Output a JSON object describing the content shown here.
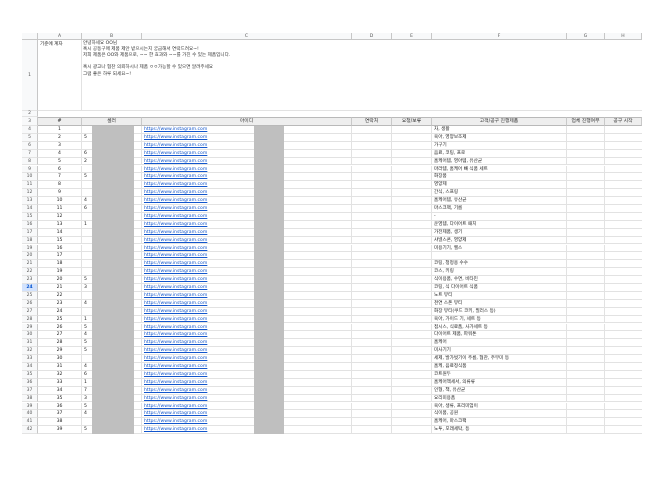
{
  "columns": [
    "A",
    "B",
    "C",
    "D",
    "E",
    "F",
    "G",
    "H"
  ],
  "intro": {
    "label": "기준에 계자",
    "lines": [
      "안녕하세요 OO님",
      "혹시 공동구매 제품 제안 받으시는지 궁금해서 연락드려요~!",
      "저희 제품은 OO와 제품으로, ~~ 한 효과와 ~~를 가진 수 있는 제품입니다.",
      "",
      "혹시 광고나 협찬 의뢰하시나 제품 ㅇㅇ가능할 수 있으면 알려주세요",
      "그럼 좋은 하루 되세요~!"
    ]
  },
  "headers": [
    "#",
    "셀러",
    "아이디",
    "연락처",
    "요청/보류",
    "고객/공구 진행제품",
    "업체 진행여부",
    "공구 시작"
  ],
  "url_text": "https://www.instagram.com",
  "selected_row": "24",
  "rows": [
    {
      "r": "4",
      "n": "1",
      "b": "",
      "f": "차, 생활"
    },
    {
      "r": "5",
      "n": "2",
      "b": "5",
      "f": "육아, 영양보조제"
    },
    {
      "r": "6",
      "n": "3",
      "b": "",
      "f": "가구기"
    },
    {
      "r": "7",
      "n": "4",
      "b": "6",
      "f": "음료, 코팅, 프로"
    },
    {
      "r": "8",
      "n": "5",
      "b": "2",
      "f": "홈케어템, 영아템, 유산균"
    },
    {
      "r": "9",
      "n": "6",
      "b": "",
      "f": "마라템, 홈케어 빼 식품 세트"
    },
    {
      "r": "10",
      "n": "7",
      "b": "5",
      "f": "화장품"
    },
    {
      "r": "11",
      "n": "8",
      "b": "",
      "f": "영양제"
    },
    {
      "r": "12",
      "n": "9",
      "b": "",
      "f": "간식, 스프링"
    },
    {
      "r": "13",
      "n": "10",
      "b": "4",
      "f": "홈케어템, 유산균"
    },
    {
      "r": "14",
      "n": "11",
      "b": "6",
      "f": "마스크팩, 기름"
    },
    {
      "r": "15",
      "n": "12",
      "b": "",
      "f": "-"
    },
    {
      "r": "16",
      "n": "13",
      "b": "1",
      "f": "운영템, 다이어트 패치"
    },
    {
      "r": "17",
      "n": "14",
      "b": "",
      "f": "가전제품, 생기"
    },
    {
      "r": "18",
      "n": "15",
      "b": "",
      "f": "샤넬스콘, 영양제"
    },
    {
      "r": "19",
      "n": "16",
      "b": "",
      "f": "미용기기, 헬스"
    },
    {
      "r": "20",
      "n": "17",
      "b": "",
      "f": ""
    },
    {
      "r": "21",
      "n": "18",
      "b": "",
      "f": "코팅, 청정용 수수"
    },
    {
      "r": "22",
      "n": "19",
      "b": "",
      "f": "코스, 키링"
    },
    {
      "r": "23",
      "n": "20",
      "b": "5",
      "f": "식이용품, 수면, 비타민"
    },
    {
      "r": "24",
      "n": "21",
      "b": "3",
      "f": "코팅, 식 다이어트 식품"
    },
    {
      "r": "25",
      "n": "22",
      "b": "",
      "f": "노트 뷰티"
    },
    {
      "r": "26",
      "n": "23",
      "b": "4",
      "f": "천연 스폰 뷰티"
    },
    {
      "r": "27",
      "n": "24",
      "b": "",
      "f": "화장 뷰티(쿠드 코키, 필러스 등)"
    },
    {
      "r": "28",
      "n": "25",
      "b": "1",
      "f": "육아, 가이드 기, 세트 등"
    },
    {
      "r": "29",
      "n": "26",
      "b": "5",
      "f": "접시스, 식료품, 사가세트 등"
    },
    {
      "r": "30",
      "n": "27",
      "b": "4",
      "f": "다이어트 제품, 파워톤"
    },
    {
      "r": "31",
      "n": "28",
      "b": "5",
      "f": "홈케어"
    },
    {
      "r": "32",
      "n": "29",
      "b": "5",
      "f": "미사기기"
    },
    {
      "r": "33",
      "n": "30",
      "b": "",
      "f": "세제, 발가벗기이 주름, 협찬, 주무미 등"
    },
    {
      "r": "34",
      "n": "31",
      "b": "4",
      "f": "홈케, 음료정식품"
    },
    {
      "r": "35",
      "n": "32",
      "b": "6",
      "f": "코트원두"
    },
    {
      "r": "36",
      "n": "33",
      "b": "1",
      "f": "홈케어액세서, 의류류"
    },
    {
      "r": "37",
      "n": "34",
      "b": "7",
      "f": "인형, 책, 유산균"
    },
    {
      "r": "38",
      "n": "35",
      "b": "3",
      "f": "요리미용품"
    },
    {
      "r": "39",
      "n": "36",
      "b": "5",
      "f": "육아, 생류, 프리미엄이"
    },
    {
      "r": "40",
      "n": "37",
      "b": "4",
      "f": "식이품, 공원"
    },
    {
      "r": "41",
      "n": "38",
      "b": "",
      "f": "홈케어, 마스크팩"
    },
    {
      "r": "42",
      "n": "39",
      "b": "5",
      "f": "노투, 모래세탁, 등"
    }
  ]
}
